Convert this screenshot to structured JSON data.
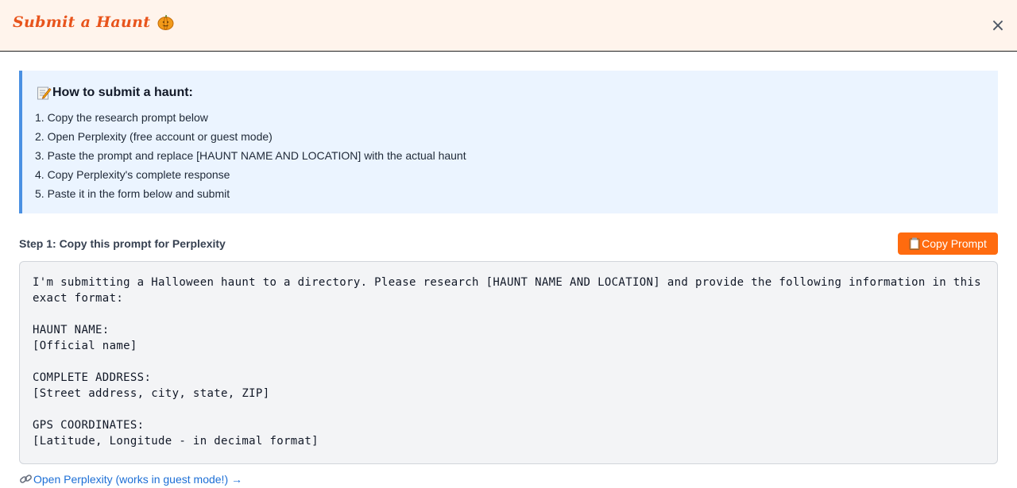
{
  "header": {
    "title": "Submit a Haunt",
    "close_label": "×"
  },
  "instructions": {
    "title": "How to submit a haunt:",
    "steps": [
      "1. Copy the research prompt below",
      "2. Open Perplexity (free account or guest mode)",
      "3. Paste the prompt and replace [HAUNT NAME AND LOCATION] with the actual haunt",
      "4. Copy Perplexity's complete response",
      "5. Paste it in the form below and submit"
    ]
  },
  "step1": {
    "label": "Step 1: Copy this prompt for Perplexity",
    "copy_button": "Copy Prompt"
  },
  "prompt": {
    "text": "I'm submitting a Halloween haunt to a directory. Please research [HAUNT NAME AND LOCATION] and provide the following information in this exact format:\n\nHAUNT NAME:\n[Official name]\n\nCOMPLETE ADDRESS:\n[Street address, city, state, ZIP]\n\nGPS COORDINATES:\n[Latitude, Longitude - in decimal format]"
  },
  "link": {
    "label": "Open Perplexity (works in guest mode!) →"
  },
  "icons": {
    "title_icon": "pumpkin-icon",
    "instructions_icon": "memo-icon",
    "copy_icon": "clipboard-icon",
    "link_icon": "link-icon",
    "close_icon": "close-icon"
  },
  "colors": {
    "header_bg": "#fff4ec",
    "title": "#e8541c",
    "instructions_bg": "#ebf4ff",
    "instructions_border": "#4a90e2",
    "button": "#ff6b0f",
    "link": "#1d6fd6"
  }
}
